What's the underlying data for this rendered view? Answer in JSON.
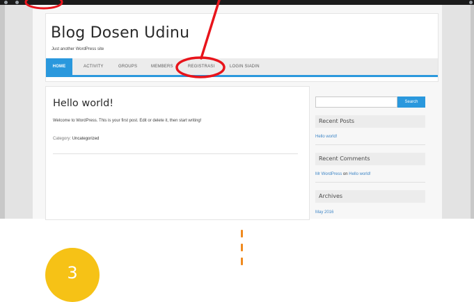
{
  "site": {
    "title": "Blog Dosen Udinu",
    "description": "Just another WordPress site"
  },
  "nav": {
    "items": [
      {
        "label": "HOME",
        "active": true
      },
      {
        "label": "ACTIVITY"
      },
      {
        "label": "GROUPS"
      },
      {
        "label": "MEMBERS"
      },
      {
        "label": "REGISTRASI",
        "highlighted": true
      },
      {
        "label": "LOGIN SIADIN"
      }
    ]
  },
  "post": {
    "title": "Hello world!",
    "body": "Welcome to WordPress. This is your first post. Edit or delete it, then start writing!",
    "category_label": "Category:",
    "category_value": "Uncategorized"
  },
  "sidebar": {
    "search_button": "Search",
    "recent_posts": {
      "heading": "Recent Posts",
      "items": [
        "Hello world!"
      ]
    },
    "recent_comments": {
      "heading": "Recent Comments",
      "author": "Mr WordPress",
      "on": "on",
      "post": "Hello world!"
    },
    "archives": {
      "heading": "Archives",
      "items": [
        "May 2016"
      ]
    }
  },
  "step": {
    "number": "3"
  },
  "colors": {
    "accent": "#2a98dd",
    "annotation": "#e8141b",
    "badge": "#f6c216",
    "dash": "#f08a1f"
  }
}
